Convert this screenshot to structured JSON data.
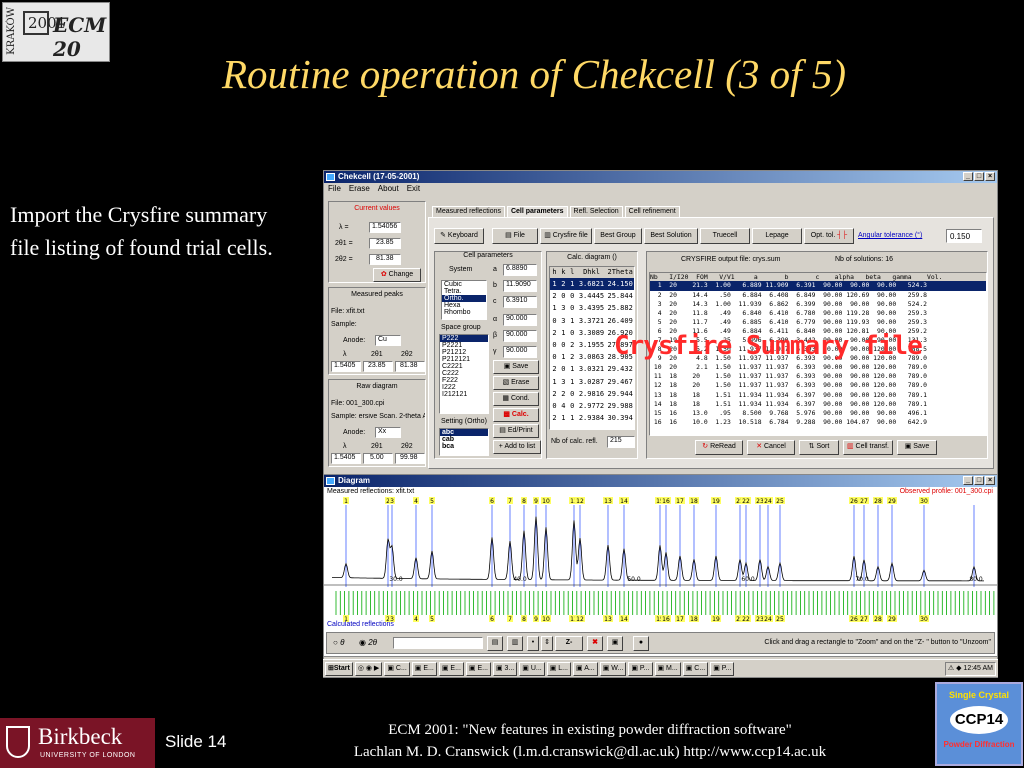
{
  "slide": {
    "logo_ecm": {
      "city": "KRAKÓW",
      "year": "2001",
      "name": "ECM 20"
    },
    "title": "Routine operation of Chekcell  (3 of 5)",
    "body_text": "Import the Crysfire summary file listing of found trial cells.",
    "overlay_label": "Crysfire Summary file",
    "slide_number": "Slide 14",
    "footer_line1": "ECM 2001: \"New features in existing powder diffraction software\"",
    "footer_line2": "Lachlan M. D. Cranswick (l.m.d.cranswick@dl.ac.uk) http://www.ccp14.ac.uk",
    "birkbeck": {
      "name": "Birkbeck",
      "sub": "UNIVERSITY OF LONDON"
    },
    "ccp14": {
      "top": "Single Crystal",
      "mid": "CCP14",
      "bot": "Powder Diffraction"
    }
  },
  "app": {
    "title": "Chekcell  (17-05-2001)",
    "menu": [
      "File",
      "Erase",
      "About",
      "Exit"
    ],
    "current_values": {
      "heading": "Current values",
      "lambda_label": "λ =",
      "lambda": "1.54056",
      "t1_label": "2θ1 =",
      "t1": "23.85",
      "t2_label": "2θ2 =",
      "t2": "81.38",
      "change": "Change"
    },
    "measured_peaks": {
      "heading": "Measured peaks",
      "file": "File: xfit.txt",
      "sample": "Sample:",
      "anode_label": "Anode:",
      "anode": "Cu",
      "h_l": "λ",
      "h_t1": "2θ1",
      "h_t2": "2θ2",
      "v_l": "1.5405",
      "v_t1": "23.85",
      "v_t2": "81.38"
    },
    "raw_diagram": {
      "heading": "Raw diagram",
      "file": "File: 001_300.cpi",
      "sample": "Sample: ersive Scan. 2-theta A",
      "anode_label": "Anode:",
      "anode": "Xx",
      "h_l": "λ",
      "h_t1": "2θ1",
      "h_t2": "2θ2",
      "v_l": "1.5405",
      "v_t1": "5.00",
      "v_t2": "99.98"
    },
    "tabs": [
      "Measured reflections",
      "Cell parameters",
      "Refl. Selection",
      "Cell refinement"
    ],
    "toolbar": [
      "Keyboard",
      "File",
      "Crysfire file",
      "Best Group",
      "Best Solution",
      "Truecell",
      "Lepage",
      "Opt. tol."
    ],
    "angular_tolerance_label": "Angular tolerance (°)",
    "angular_tolerance": "0.150",
    "cell_params": {
      "heading": "Cell parameters",
      "system_label": "System",
      "systems": [
        "Cubic",
        "Tetra.",
        "Ortho.",
        "Hexa",
        "Rhombo"
      ],
      "a_label": "a",
      "a": "6.8890",
      "b_label": "b",
      "b": "11.9090",
      "c_label": "c",
      "c": "6.3910",
      "alpha_label": "α",
      "alpha": "90.000",
      "beta_label": "β",
      "beta": "90.000",
      "gamma_label": "γ",
      "gamma": "90.000",
      "space_group_label": "Space group",
      "space_groups": [
        "P222",
        "P2221",
        "P21212",
        "P212121",
        "C2221",
        "C222",
        "F222",
        "I222",
        "I212121"
      ],
      "setting_label": "Setting (Ortho)",
      "settings": [
        "abc",
        "cab",
        "bca"
      ],
      "buttons": [
        "Save",
        "Erase",
        "Cond.",
        "Calc.",
        "Ed/Print",
        "Add to list"
      ]
    },
    "calc_diagram": {
      "heading": "Calc. diagram ()",
      "cols": [
        "h",
        "k",
        "l",
        "Dhkl",
        "2Theta"
      ],
      "rows": [
        [
          "1",
          "2",
          "1",
          "3.6821",
          "24.150"
        ],
        [
          "2",
          "0",
          "0",
          "3.4445",
          "25.844"
        ],
        [
          "1",
          "3",
          "0",
          "3.4395",
          "25.882"
        ],
        [
          "0",
          "3",
          "1",
          "3.3721",
          "26.409"
        ],
        [
          "2",
          "1",
          "0",
          "3.3089",
          "26.920"
        ],
        [
          "0",
          "0",
          "2",
          "3.1955",
          "27.897"
        ],
        [
          "0",
          "1",
          "2",
          "3.0863",
          "28.905"
        ],
        [
          "2",
          "0",
          "1",
          "3.0321",
          "29.432"
        ],
        [
          "1",
          "3",
          "1",
          "3.0287",
          "29.467"
        ],
        [
          "2",
          "2",
          "0",
          "2.9816",
          "29.944"
        ],
        [
          "0",
          "4",
          "0",
          "2.9772",
          "29.988"
        ],
        [
          "2",
          "1",
          "1",
          "2.9384",
          "30.394"
        ]
      ],
      "count_label": "Nb of calc. refl.",
      "count": "215"
    },
    "crysfire": {
      "file_label": "CRYSFIRE output file: crys.sum",
      "nb_label": "Nb of solutions: 16",
      "header": "Nb   I/I20  FOM   V/V1     a       b       c    alpha   beta   gamma    Vol.",
      "rows": [
        "  1  20    21.3  1.00   6.889 11.909  6.391  90.00  90.00  90.00   524.3",
        "  2  20    14.4   .50   6.884  6.408  6.849  90.00 120.69  90.00   259.8",
        "  3  20    14.3  1.00  11.939  6.862  6.399  90.00  90.00  90.00   524.2",
        "  4  20    11.8   .49   6.840  6.410  6.780  90.00 119.28  90.00   259.3",
        "  5  20    11.7   .49   6.885  6.410  6.779  90.00 119.93  90.00   259.3",
        "  6  20    11.6   .49   6.884  6.411  6.840  90.00 120.81  90.00   259.2",
        "  7  19     5.5   .25   5.996  6.390  3.442  90.00  90.00  90.00   131.3",
        "  8  20     5.2  1.50  11.937 11.937  6.393  90.00  90.00 120.00   788.5",
        "  9  20     4.8  1.50  11.937 11.937  6.393  90.00  90.00 120.00   789.0",
        " 10  20     2.1  1.50  11.937 11.937  6.393  90.00  90.00 120.00   789.0",
        " 11  18    20    1.50  11.937 11.937  6.393  90.00  90.00 120.00   789.0",
        " 12  18    20    1.50  11.937 11.937  6.393  90.00  90.00 120.00   789.0",
        " 13  18    18    1.51  11.934 11.934  6.397  90.00  90.00 120.00   789.1",
        " 14  18    18    1.51  11.934 11.934  6.397  90.00  90.00 120.00   789.1",
        " 15  16    13.0   .95   8.500  9.768  5.976  90.00  90.00  90.00   496.1",
        " 16  16    10.0  1.23  10.518  6.784  9.288  90.00 104.07  90.00   642.9"
      ],
      "buttons": [
        "ReRead",
        "Cancel",
        "Sort",
        "Cell transf.",
        "Save"
      ]
    },
    "diagram": {
      "title": "Diagram",
      "measured": "Measured reflections: xfit.txt",
      "observed": "Observed profile: 001_300.cpi",
      "calculated": "Calculated reflections",
      "axis_ticks": [
        "30.0",
        "40.0",
        "50.0",
        "60.0",
        "70.0",
        "80.0"
      ],
      "peak_labels": [
        "1",
        "2",
        "3",
        "4",
        "5",
        "6",
        "7",
        "8",
        "9",
        "10",
        "11",
        "12",
        "13",
        "14",
        "15",
        "16",
        "17",
        "18",
        "19",
        "21",
        "22",
        "23",
        "24",
        "25",
        "26",
        "27",
        "28",
        "29",
        "30"
      ],
      "opt_theta": "θ",
      "opt_2theta": "2θ",
      "hint": "Click and drag a rectangle to \"Zoom\" and  on the \"Z- \" button to \"Unzoom\""
    },
    "taskbar": {
      "start": "Start",
      "items": [
        "C...",
        "E...",
        "E...",
        "E...",
        "3...",
        "U...",
        "L...",
        "A...",
        "W...",
        "P...",
        "M...",
        "C...",
        "P..."
      ],
      "clock": "12:45 AM"
    }
  }
}
